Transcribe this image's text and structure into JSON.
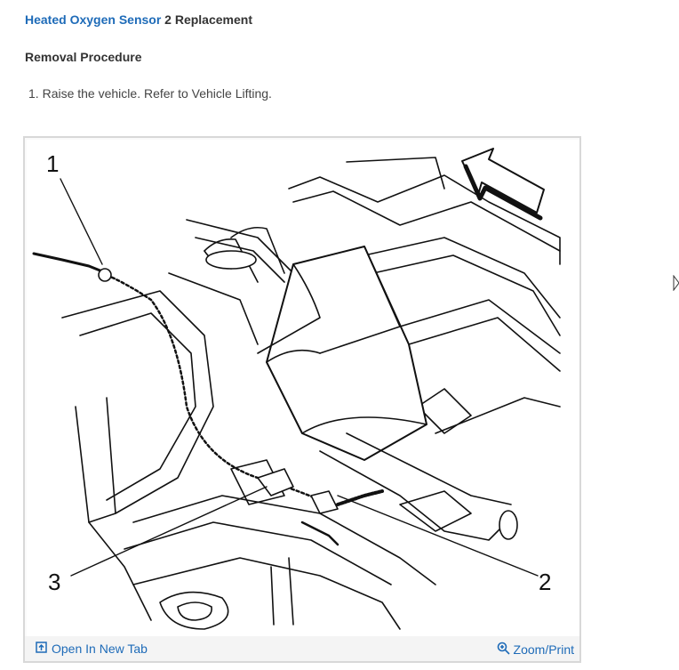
{
  "header": {
    "title_link": "Heated Oxygen Sensor",
    "title_rest": "2 Replacement"
  },
  "section_title": "Removal Procedure",
  "steps": [
    {
      "number": "1.",
      "text": "Raise the vehicle. Refer to Vehicle Lifting."
    }
  ],
  "figure": {
    "callouts": [
      "1",
      "2",
      "3"
    ],
    "open_tab_label": "Open In New Tab",
    "open_tab_icon": "open-in-new-tab-icon",
    "zoom_label": "Zoom/Print",
    "zoom_icon": "magnifier-icon"
  },
  "colors": {
    "link": "#1e6bb8",
    "text": "#333333"
  }
}
